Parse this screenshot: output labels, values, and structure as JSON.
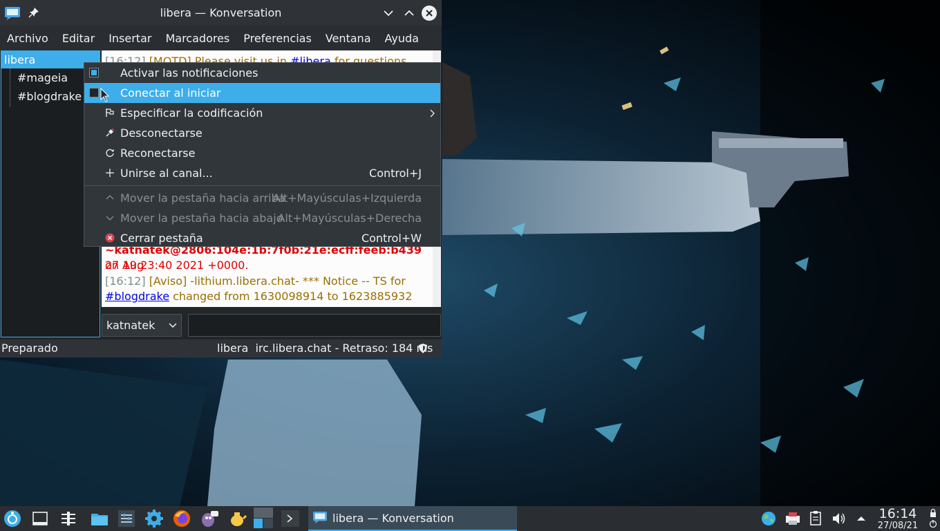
{
  "window": {
    "title": "libera — Konversation",
    "menus": [
      "Archivo",
      "Editar",
      "Insertar",
      "Marcadores",
      "Preferencias",
      "Ventana",
      "Ayuda"
    ]
  },
  "sidebar": {
    "server": "libera",
    "channels": [
      "#mageia",
      "#blogdrake"
    ]
  },
  "chat": {
    "line1": {
      "ts": "[16:12]",
      "tag": "[MOTD]",
      "text": " Please visit us in ",
      "link": "#libera",
      "tail": " for questions and"
    },
    "line2": {
      "nick": "~katnatek@2806:104e:1b:7f0b:21e:ecff:feeb:b439",
      "text": " on Aug"
    },
    "line3": {
      "text": "27 19:23:40 2021 +0000."
    },
    "line4": {
      "ts": "[16:12]",
      "tag": "[Aviso]",
      "text": " -lithium.libera.chat- *** Notice -- TS for"
    },
    "line5": {
      "link": "#blogdrake",
      "text": " changed from 1630098914 to 1623885932"
    }
  },
  "input": {
    "nick": "katnatek",
    "value": ""
  },
  "statusbar": {
    "left": "Preparado",
    "right": "libera  irc.libera.chat - Retraso: 184 ms"
  },
  "context_menu": {
    "items": [
      {
        "label": "Activar las notificaciones",
        "shortcut": "",
        "checkbox": true,
        "checked": true,
        "disabled": false
      },
      {
        "label": "Conectar al iniciar",
        "shortcut": "",
        "checkbox": true,
        "checked": false,
        "highlighted": true,
        "disabled": false
      },
      {
        "label": "Especificar la codificación",
        "shortcut": "",
        "icon": "flag-icon",
        "submenu": true,
        "disabled": false
      },
      {
        "label": "Desconectarse",
        "shortcut": "",
        "icon": "disconnect-icon",
        "disabled": false
      },
      {
        "label": "Reconectarse",
        "shortcut": "",
        "icon": "reload-icon",
        "disabled": false
      },
      {
        "label": "Unirse al canal...",
        "shortcut": "Control+J",
        "icon": "plus-icon",
        "disabled": false
      },
      {
        "label": "Mover la pestaña hacia arriba",
        "shortcut": "Alt+Mayúsculas+Izquierda",
        "icon": "chevron-up-icon",
        "disabled": true
      },
      {
        "label": "Mover la pestaña hacia abajo",
        "shortcut": "Alt+Mayúsculas+Derecha",
        "icon": "chevron-down-icon",
        "disabled": true
      },
      {
        "label": "Cerrar pestaña",
        "shortcut": "Control+W",
        "icon": "close-tab-icon",
        "disabled": false
      }
    ]
  },
  "taskbar": {
    "active_task": "libera — Konversation",
    "time": "16:14",
    "date": "27/08/21"
  },
  "colors": {
    "accent": "#3daee9",
    "window_bg": "#232629",
    "menu_bg": "#31363b"
  }
}
